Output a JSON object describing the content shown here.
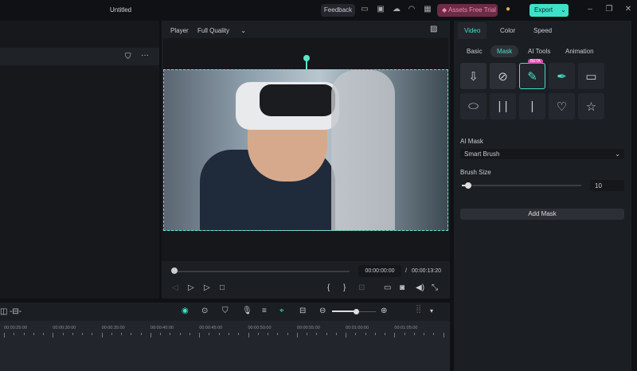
{
  "window": {
    "title": "Untitled"
  },
  "topbar": {
    "feedback": "Feedback",
    "assets": "Assets Free Trial",
    "export": "Export"
  },
  "player": {
    "label": "Player",
    "quality": "Full Quality",
    "current_time": "00:00:00:00",
    "separator": "/",
    "total_time": "00:00:13:20"
  },
  "right": {
    "tabs": [
      "Video",
      "Color",
      "Speed"
    ],
    "subtabs": [
      "Basic",
      "Mask",
      "AI Tools",
      "Animation"
    ],
    "beta": "BETA",
    "ai_mask_label": "AI Mask",
    "ai_mask_value": "Smart Brush",
    "brush_size_label": "Brush Size",
    "brush_size_value": "10",
    "brush_size_fraction": 0.05,
    "add_mask": "Add Mask"
  },
  "timeline": {
    "ticks": [
      "00:00:25:00",
      "00:00:30:00",
      "00:00:35:00",
      "00:00:40:00",
      "00:00:45:00",
      "00:00:50:00",
      "00:00:55:00",
      "00:01:00:00",
      "00:01:05:00"
    ],
    "zoom_fraction": 0.55
  },
  "colors": {
    "accent": "#3fe0c8",
    "assets": "#f28ab0"
  }
}
